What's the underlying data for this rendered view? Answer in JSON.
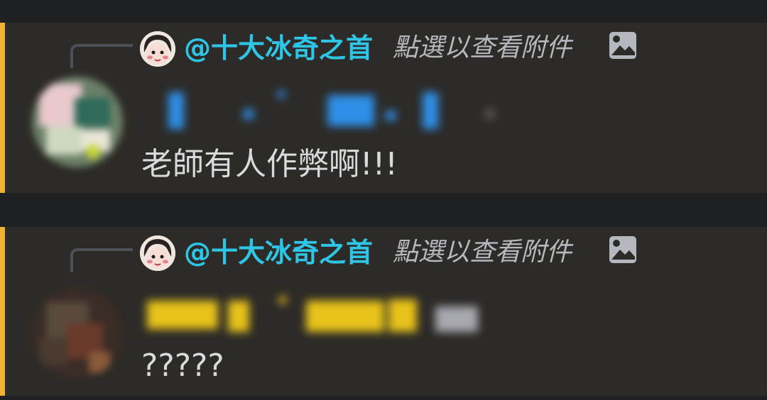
{
  "messages": [
    {
      "reply": {
        "author": "@十大冰奇之首",
        "attachment_hint": "點選以查看附件",
        "attachment_icon": "image-icon"
      },
      "text": "老師有人作弊啊!!!",
      "accent": "#f0b232",
      "name_color": "#2f8fe8"
    },
    {
      "reply": {
        "author": "@十大冰奇之首",
        "attachment_hint": "點選以查看附件",
        "attachment_icon": "image-icon"
      },
      "text": "?????",
      "accent": "#f0b232",
      "name_color": "#e8c31a"
    }
  ]
}
